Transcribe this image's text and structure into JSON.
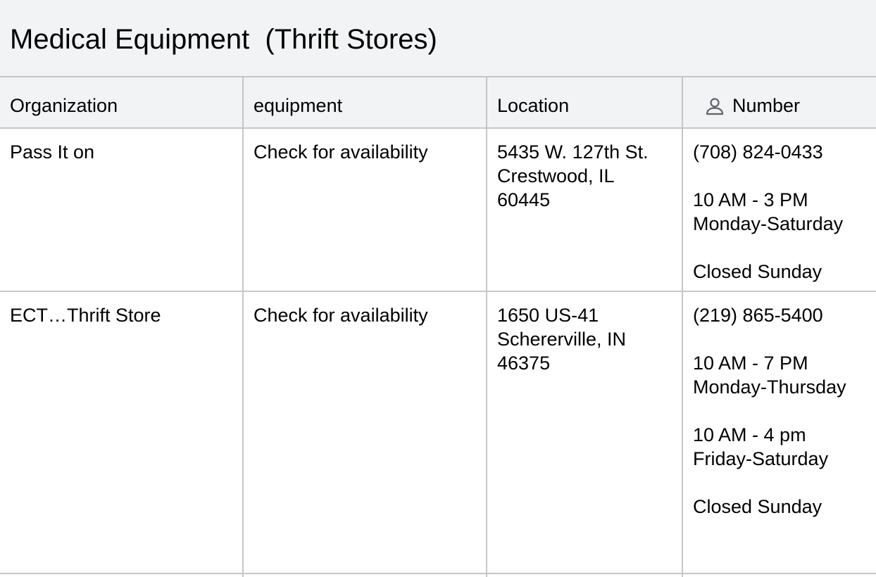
{
  "title": "Medical Equipment  (Thrift Stores)",
  "columns": [
    "Organization",
    "equipment",
    "Location",
    "Number"
  ],
  "number_column_icon": "person-icon",
  "rows": [
    {
      "organization": "Pass It on",
      "equipment": "Check for availability",
      "location": "5435 W. 127th St.\nCrestwood, IL\n60445",
      "number": "(708) 824-0433\n\n10 AM - 3 PM\nMonday-Saturday\n\nClosed Sunday"
    },
    {
      "organization": "ECT…Thrift Store",
      "equipment": "Check for availability",
      "location": "1650 US-41\nSchererville, IN\n46375",
      "number": "(219) 865-5400\n\n10 AM - 7 PM\nMonday-Thursday\n\n10 AM - 4 pm\nFriday-Saturday\n\nClosed Sunday"
    }
  ],
  "colors": {
    "header_background": "#f1f3f4",
    "grid_line": "#c6c6c6",
    "icon_color": "#5f6368"
  }
}
